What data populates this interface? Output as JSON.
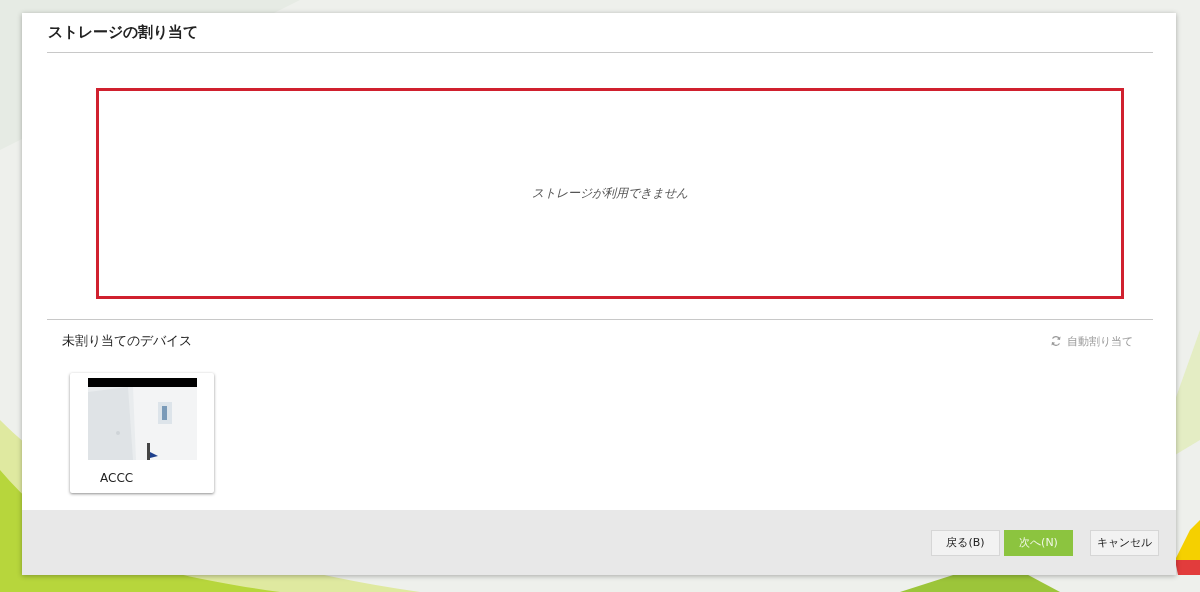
{
  "dialog": {
    "title": "ストレージの割り当て"
  },
  "storage_area": {
    "message": "ストレージが利用できません",
    "error": true
  },
  "unassigned": {
    "label": "未割り当てのデバイス",
    "auto_assign": {
      "label": "自動割り当て",
      "disabled": true
    },
    "devices": [
      {
        "name": "ACCC"
      }
    ]
  },
  "buttons": [
    {
      "label": "戻る(B)",
      "kind": "default"
    },
    {
      "label": "次へ(N)",
      "kind": "primary"
    },
    {
      "label": "キャンセル",
      "kind": "default"
    }
  ]
}
